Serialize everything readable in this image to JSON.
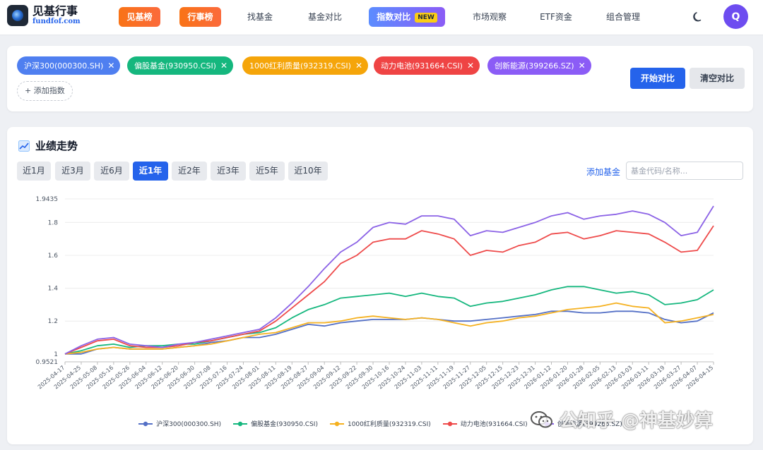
{
  "brand": {
    "title": "见基行事",
    "subtitle": "fundfof.com"
  },
  "nav": {
    "items": [
      "见基榜",
      "行事榜",
      "找基金",
      "基金对比",
      "指数对比",
      "市场观察",
      "ETF资金",
      "组合管理"
    ],
    "new_badge": "NEW",
    "avatar_letter": "Q"
  },
  "selection": {
    "chips": [
      {
        "label": "沪深300(000300.SH)",
        "color": "#4f7ff0"
      },
      {
        "label": "偏股基金(930950.CSI)",
        "color": "#15b77e"
      },
      {
        "label": "1000红利质量(932319.CSI)",
        "color": "#f5a50a"
      },
      {
        "label": "动力电池(931664.CSI)",
        "color": "#ef4444"
      },
      {
        "label": "创新能源(399266.SZ)",
        "color": "#8b5cf6"
      }
    ],
    "remove_glyph": "✕",
    "add_index": "+ 添加指数",
    "start_compare": "开始对比",
    "clear_compare": "清空对比"
  },
  "chart_section": {
    "title": "业绩走势",
    "periods": [
      "近1月",
      "近3月",
      "近6月",
      "近1年",
      "近2年",
      "近3年",
      "近5年",
      "近10年"
    ],
    "active_period": "近1年",
    "add_fund": "添加基金",
    "fund_placeholder": "基金代码/名称..."
  },
  "chart_data": {
    "type": "line",
    "ylim": [
      0.9521,
      1.9435
    ],
    "y_ticks": [
      "0.9521",
      "1",
      "1.2",
      "1.4",
      "1.6",
      "1.8",
      "1.9435"
    ],
    "y_tick_values": [
      0.9521,
      1,
      1.2,
      1.4,
      1.6,
      1.8,
      1.9435
    ],
    "grid": true,
    "legend": "bottom",
    "x_ticks": [
      "2025-04-17",
      "2025-04-25",
      "2025-05-08",
      "2025-05-16",
      "2025-05-26",
      "2025-06-04",
      "2025-06-12",
      "2025-06-20",
      "2025-06-30",
      "2025-07-08",
      "2025-07-16",
      "2025-07-24",
      "2025-08-01",
      "2025-08-11",
      "2025-08-19",
      "2025-08-27",
      "2025-09-04",
      "2025-09-12",
      "2025-09-22",
      "2025-09-30",
      "2025-10-16",
      "2025-10-24",
      "2025-11-03",
      "2025-11-11",
      "2025-11-19",
      "2025-11-27",
      "2025-12-05",
      "2025-12-15",
      "2025-12-23",
      "2025-12-31",
      "2026-01-12",
      "2026-01-20",
      "2026-01-28",
      "2026-02-05",
      "2026-02-13",
      "2026-03-03",
      "2026-03-11",
      "2026-03-19",
      "2026-03-27",
      "2026-04-07",
      "2026-04-15"
    ],
    "series": [
      {
        "name": "沪深300(000300.SH)",
        "color": "#5470c6",
        "values": [
          1.0,
          1.0,
          1.03,
          1.04,
          1.03,
          1.03,
          1.03,
          1.04,
          1.05,
          1.07,
          1.08,
          1.1,
          1.1,
          1.12,
          1.15,
          1.18,
          1.17,
          1.19,
          1.2,
          1.21,
          1.21,
          1.21,
          1.22,
          1.21,
          1.2,
          1.2,
          1.21,
          1.22,
          1.23,
          1.24,
          1.26,
          1.26,
          1.25,
          1.25,
          1.26,
          1.26,
          1.25,
          1.21,
          1.19,
          1.2,
          1.25
        ]
      },
      {
        "name": "偏股基金(930950.CSI)",
        "color": "#15b77e",
        "values": [
          1.0,
          1.02,
          1.05,
          1.06,
          1.04,
          1.05,
          1.05,
          1.06,
          1.06,
          1.08,
          1.1,
          1.12,
          1.13,
          1.16,
          1.22,
          1.27,
          1.3,
          1.34,
          1.35,
          1.36,
          1.37,
          1.35,
          1.37,
          1.35,
          1.34,
          1.29,
          1.31,
          1.32,
          1.34,
          1.36,
          1.39,
          1.41,
          1.41,
          1.39,
          1.37,
          1.38,
          1.36,
          1.3,
          1.31,
          1.33,
          1.39
        ]
      },
      {
        "name": "1000红利质量(932319.CSI)",
        "color": "#f5b120",
        "values": [
          1.0,
          1.01,
          1.03,
          1.04,
          1.03,
          1.03,
          1.03,
          1.04,
          1.05,
          1.06,
          1.08,
          1.1,
          1.12,
          1.13,
          1.16,
          1.19,
          1.19,
          1.2,
          1.22,
          1.23,
          1.22,
          1.21,
          1.22,
          1.21,
          1.19,
          1.17,
          1.19,
          1.2,
          1.22,
          1.23,
          1.25,
          1.27,
          1.28,
          1.29,
          1.31,
          1.29,
          1.28,
          1.19,
          1.2,
          1.22,
          1.24
        ]
      },
      {
        "name": "动力电池(931664.CSI)",
        "color": "#ee4a4a",
        "values": [
          1.0,
          1.04,
          1.08,
          1.09,
          1.05,
          1.04,
          1.04,
          1.05,
          1.07,
          1.08,
          1.1,
          1.12,
          1.14,
          1.2,
          1.28,
          1.36,
          1.44,
          1.55,
          1.6,
          1.68,
          1.7,
          1.7,
          1.75,
          1.73,
          1.7,
          1.6,
          1.63,
          1.62,
          1.66,
          1.68,
          1.73,
          1.74,
          1.7,
          1.72,
          1.75,
          1.74,
          1.73,
          1.68,
          1.62,
          1.63,
          1.78
        ]
      },
      {
        "name": "创新能源(399266.SZ)",
        "color": "#8b62e6",
        "values": [
          1.0,
          1.05,
          1.09,
          1.1,
          1.06,
          1.05,
          1.04,
          1.06,
          1.07,
          1.09,
          1.11,
          1.13,
          1.15,
          1.22,
          1.31,
          1.41,
          1.52,
          1.62,
          1.68,
          1.77,
          1.8,
          1.79,
          1.84,
          1.84,
          1.82,
          1.72,
          1.75,
          1.74,
          1.77,
          1.8,
          1.84,
          1.86,
          1.82,
          1.84,
          1.85,
          1.87,
          1.85,
          1.8,
          1.72,
          1.74,
          1.9
        ]
      }
    ]
  },
  "legend_marker": "line-dot",
  "watermark": {
    "text": "知乎 @神基妙算",
    "prefix": "公"
  },
  "icons": {
    "theme": "moon-icon",
    "chart": "trend-icon",
    "close": "close-icon",
    "wechat": "wechat-icon"
  }
}
